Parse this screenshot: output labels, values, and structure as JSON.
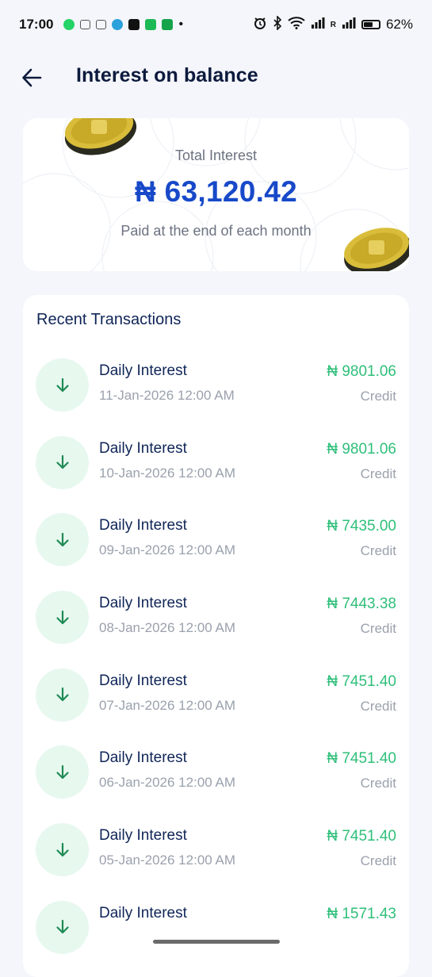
{
  "status_bar": {
    "time": "17:00",
    "app_icons": [
      "whatsapp-icon",
      "message-icon",
      "message-icon",
      "telegram-icon",
      "app-icon",
      "app-icon",
      "app-icon"
    ],
    "dot": "•",
    "carrier_label": "R",
    "battery_percent": "62%",
    "battery_level": 0.62
  },
  "header": {
    "title": "Interest on balance",
    "back_icon": "arrow-left-icon"
  },
  "summary": {
    "label": "Total Interest",
    "amount": "₦ 63,120.42",
    "note": "Paid at the end of each month"
  },
  "transactions": {
    "heading": "Recent Transactions",
    "items": [
      {
        "title": "Daily Interest",
        "date": "11-Jan-2026 12:00 AM",
        "amount": "₦ 9801.06",
        "type": "Credit"
      },
      {
        "title": "Daily Interest",
        "date": "10-Jan-2026 12:00 AM",
        "amount": "₦ 9801.06",
        "type": "Credit"
      },
      {
        "title": "Daily Interest",
        "date": "09-Jan-2026 12:00 AM",
        "amount": "₦ 7435.00",
        "type": "Credit"
      },
      {
        "title": "Daily Interest",
        "date": "08-Jan-2026 12:00 AM",
        "amount": "₦ 7443.38",
        "type": "Credit"
      },
      {
        "title": "Daily Interest",
        "date": "07-Jan-2026 12:00 AM",
        "amount": "₦ 7451.40",
        "type": "Credit"
      },
      {
        "title": "Daily Interest",
        "date": "06-Jan-2026 12:00 AM",
        "amount": "₦ 7451.40",
        "type": "Credit"
      },
      {
        "title": "Daily Interest",
        "date": "05-Jan-2026 12:00 AM",
        "amount": "₦ 7451.40",
        "type": "Credit"
      },
      {
        "title": "Daily Interest",
        "date": "",
        "amount": "₦ 1571.43",
        "type": ""
      }
    ]
  },
  "colors": {
    "accent_blue": "#1749c9",
    "credit_green": "#2fbf7a",
    "icon_bg": "#e7f8ef",
    "icon_arrow": "#1f8a55"
  }
}
